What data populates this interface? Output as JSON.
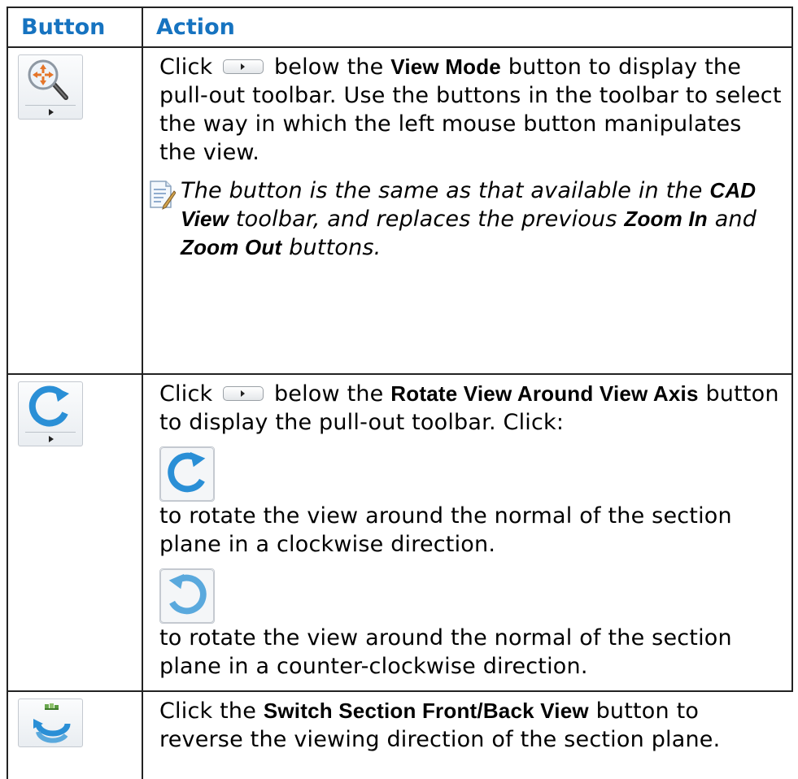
{
  "header": {
    "col_button": "Button",
    "col_action": "Action"
  },
  "rows": [
    {
      "icon": "view-mode-icon",
      "p1_a": "Click",
      "p1_b": "below the",
      "p1_bold": "View Mode",
      "p1_c": "button to display the pull-out toolbar. Use the buttons in the toolbar to select the way in which the left mouse button manipulates the view.",
      "note_icon": "note-pencil-icon",
      "note_a": "The button is the same as that available in the",
      "note_bold1": "CAD View",
      "note_b": "toolbar, and replaces the previous",
      "note_bold2": "Zoom In",
      "note_c": "and",
      "note_bold3": "Zoom Out",
      "note_d": "buttons."
    },
    {
      "icon": "rotate-view-icon",
      "p1_a": "Click",
      "p1_b": "below the",
      "p1_bold": "Rotate View Around View Axis",
      "p1_c": "button to display the pull-out toolbar. Click:",
      "cw_icon": "rotate-clockwise-icon",
      "cw_text": "to rotate the view around the normal of the section plane in a clockwise direction.",
      "ccw_icon": "rotate-counterclockwise-icon",
      "ccw_text": "to rotate the view around the normal of the section plane in a counter-clockwise direction."
    },
    {
      "icon": "switch-section-icon",
      "p1_a": "Click the",
      "p1_bold": "Switch Section Front/Back View",
      "p1_c": "button to reverse the viewing direction of the section plane."
    }
  ],
  "colors": {
    "heading": "#1673c0",
    "icon_blue": "#2a8fd6",
    "border": "#222222"
  }
}
